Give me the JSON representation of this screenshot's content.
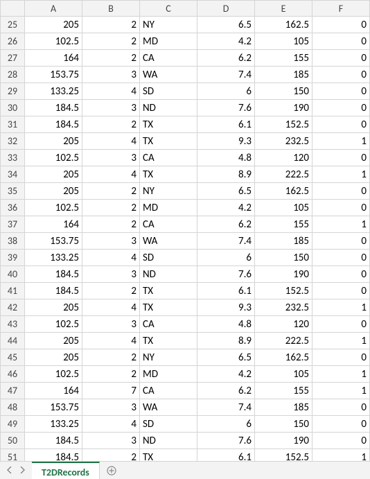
{
  "columns": [
    "A",
    "B",
    "C",
    "D",
    "E",
    "F"
  ],
  "first_row": 25,
  "rows": [
    {
      "A": 205,
      "B": 2,
      "C": "NY",
      "D": 6.5,
      "E": 162.5,
      "F": 0
    },
    {
      "A": 102.5,
      "B": 2,
      "C": "MD",
      "D": 4.2,
      "E": 105,
      "F": 0
    },
    {
      "A": 164,
      "B": 2,
      "C": "CA",
      "D": 6.2,
      "E": 155,
      "F": 0
    },
    {
      "A": 153.75,
      "B": 3,
      "C": "WA",
      "D": 7.4,
      "E": 185,
      "F": 0
    },
    {
      "A": 133.25,
      "B": 4,
      "C": "SD",
      "D": 6,
      "E": 150,
      "F": 0
    },
    {
      "A": 184.5,
      "B": 3,
      "C": "ND",
      "D": 7.6,
      "E": 190,
      "F": 0
    },
    {
      "A": 184.5,
      "B": 2,
      "C": "TX",
      "D": 6.1,
      "E": 152.5,
      "F": 0
    },
    {
      "A": 205,
      "B": 4,
      "C": "TX",
      "D": 9.3,
      "E": 232.5,
      "F": 1
    },
    {
      "A": 102.5,
      "B": 3,
      "C": "CA",
      "D": 4.8,
      "E": 120,
      "F": 0
    },
    {
      "A": 205,
      "B": 4,
      "C": "TX",
      "D": 8.9,
      "E": 222.5,
      "F": 1
    },
    {
      "A": 205,
      "B": 2,
      "C": "NY",
      "D": 6.5,
      "E": 162.5,
      "F": 0
    },
    {
      "A": 102.5,
      "B": 2,
      "C": "MD",
      "D": 4.2,
      "E": 105,
      "F": 0
    },
    {
      "A": 164,
      "B": 2,
      "C": "CA",
      "D": 6.2,
      "E": 155,
      "F": 1
    },
    {
      "A": 153.75,
      "B": 3,
      "C": "WA",
      "D": 7.4,
      "E": 185,
      "F": 0
    },
    {
      "A": 133.25,
      "B": 4,
      "C": "SD",
      "D": 6,
      "E": 150,
      "F": 0
    },
    {
      "A": 184.5,
      "B": 3,
      "C": "ND",
      "D": 7.6,
      "E": 190,
      "F": 0
    },
    {
      "A": 184.5,
      "B": 2,
      "C": "TX",
      "D": 6.1,
      "E": 152.5,
      "F": 0
    },
    {
      "A": 205,
      "B": 4,
      "C": "TX",
      "D": 9.3,
      "E": 232.5,
      "F": 1
    },
    {
      "A": 102.5,
      "B": 3,
      "C": "CA",
      "D": 4.8,
      "E": 120,
      "F": 0
    },
    {
      "A": 205,
      "B": 4,
      "C": "TX",
      "D": 8.9,
      "E": 222.5,
      "F": 1
    },
    {
      "A": 205,
      "B": 2,
      "C": "NY",
      "D": 6.5,
      "E": 162.5,
      "F": 0
    },
    {
      "A": 102.5,
      "B": 2,
      "C": "MD",
      "D": 4.2,
      "E": 105,
      "F": 1
    },
    {
      "A": 164,
      "B": 7,
      "C": "CA",
      "D": 6.2,
      "E": 155,
      "F": 1
    },
    {
      "A": 153.75,
      "B": 3,
      "C": "WA",
      "D": 7.4,
      "E": 185,
      "F": 0
    },
    {
      "A": 133.25,
      "B": 4,
      "C": "SD",
      "D": 6,
      "E": 150,
      "F": 0
    },
    {
      "A": 184.5,
      "B": 3,
      "C": "ND",
      "D": 7.6,
      "E": 190,
      "F": 0
    },
    {
      "A": 184.5,
      "B": 2,
      "C": "TX",
      "D": 6.1,
      "E": 152.5,
      "F": 1
    }
  ],
  "text_columns": [
    "C"
  ],
  "sheet_tabs": {
    "active": "T2DRecords"
  }
}
